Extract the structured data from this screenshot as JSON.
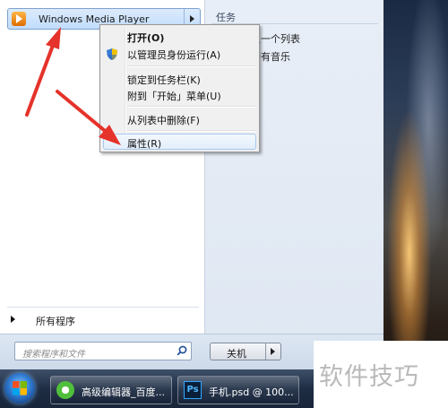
{
  "start_menu": {
    "pinned_item": {
      "label": "Windows Media Player"
    },
    "right_panel": {
      "section_title": "任务",
      "items": [
        "上一个列表",
        "所有音乐"
      ]
    },
    "all_programs_label": "所有程序",
    "search": {
      "placeholder": "搜索程序和文件"
    },
    "shutdown_label": "关机"
  },
  "context_menu": {
    "items": [
      {
        "label": "打开(O)",
        "bold": true
      },
      {
        "label": "以管理员身份运行(A)",
        "icon": "shield-icon"
      },
      {
        "label": "锁定到任务栏(K)"
      },
      {
        "label": "附到「开始」菜单(U)"
      },
      {
        "label": "从列表中删除(F)"
      },
      {
        "label": "属性(R)",
        "highlighted": true
      }
    ]
  },
  "taskbar": {
    "items": [
      {
        "label": "高级编辑器_百度...",
        "icon": "browser-icon"
      },
      {
        "label": "手机.psd @ 100...",
        "icon": "photoshop-icon",
        "icon_text": "Ps"
      }
    ]
  },
  "watermark": "软件技巧",
  "colors": {
    "annotation_arrow": "#e5322a",
    "highlight": "#c1dcfb"
  }
}
